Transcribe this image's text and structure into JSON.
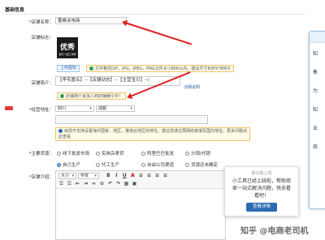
{
  "section_title": "基础信息",
  "shop_name": {
    "label": "*店铺名称：",
    "value": "董蜂谈电商"
  },
  "logo": {
    "label": "店铺标志：",
    "brand": "优秀",
    "brand_sub": "我们一起工作吧",
    "upload": "上传图标",
    "tip": "文件格式GIF，JPG，JPEG，PNG文件大小80K以内，建议尺寸80PX*80PX"
  },
  "intro_short": {
    "label": "店铺简介：",
    "value": "【李宅置名】--【店铺动态】--【主营宝贝】--/",
    "link": "详细说明",
    "tip": "店铺简介会加入到店铺索引中！"
  },
  "address": {
    "label": "*经营地址：",
    "province": "四川",
    "city": "成都",
    "tip": "目前不支持设置海外国家，地区，港澳台地区的地址，建议您通过再网商家填写国内地址，更多问题点此查看"
  },
  "source": {
    "label": "*主要货源：",
    "options": [
      "线下批发市场",
      "实体店拿货",
      "阿里巴巴批发",
      "分销/代销",
      "自己生产",
      "代工生产",
      "自由公司渠道",
      "货源还未确定"
    ],
    "selected": 4
  },
  "intro": {
    "label": "*店铺介绍：",
    "font_size": "大小",
    "font_family": "字体"
  },
  "popup": {
    "tag": "新功能上线",
    "text": "小工具已经上线啦，帮助商家一站式解决问题，快去看看吧！",
    "button": "查看详情"
  },
  "side_texts": [
    "知",
    "售",
    "为",
    "知",
    "业",
    "商"
  ],
  "watermark": "知乎 @电商老司机",
  "colors": {
    "accent": "#2a6ab2",
    "arrow": "#e02020",
    "tip_border": "#f0c36d",
    "required": "#e4393c"
  }
}
